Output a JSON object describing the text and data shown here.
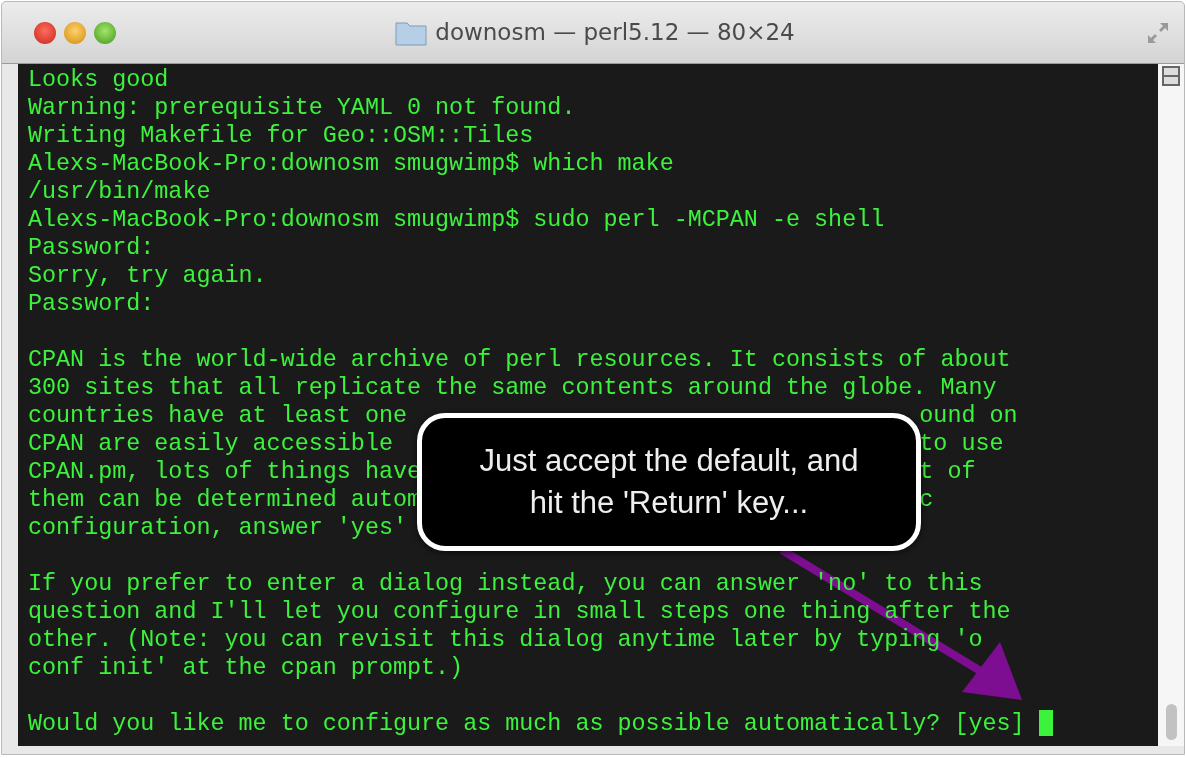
{
  "window": {
    "title": "downosm — perl5.12 — 80×24"
  },
  "terminal": {
    "lines": [
      {
        "kind": "text",
        "text": "Looks good"
      },
      {
        "kind": "text",
        "text": "Warning: prerequisite YAML 0 not found."
      },
      {
        "kind": "text",
        "text": "Writing Makefile for Geo::OSM::Tiles"
      },
      {
        "kind": "text",
        "text": "Alexs-MacBook-Pro:downosm smugwimp$ which make"
      },
      {
        "kind": "text",
        "text": "/usr/bin/make"
      },
      {
        "kind": "text",
        "text": "Alexs-MacBook-Pro:downosm smugwimp$ sudo perl -MCPAN -e shell"
      },
      {
        "kind": "text",
        "text": "Password:"
      },
      {
        "kind": "text",
        "text": "Sorry, try again."
      },
      {
        "kind": "text",
        "text": "Password:"
      },
      {
        "kind": "blank"
      },
      {
        "kind": "text",
        "text": "CPAN is the world-wide archive of perl resources. It consists of about"
      },
      {
        "kind": "text",
        "text": "300 sites that all replicate the same contents around the globe. Many"
      },
      {
        "kind": "text",
        "text": "countries have at least one",
        "tail": "ound on"
      },
      {
        "kind": "text",
        "text": "CPAN are easily accessible",
        "tail": "to use"
      },
      {
        "kind": "text",
        "text": "CPAN.pm, lots of things have",
        "tail": "t of"
      },
      {
        "kind": "text",
        "text": "them can be determined autom",
        "tail": "c"
      },
      {
        "kind": "text",
        "text": "configuration, answer 'yes'"
      },
      {
        "kind": "blank"
      },
      {
        "kind": "text",
        "text": "If you prefer to enter a dialog instead, you can answer 'no' to this"
      },
      {
        "kind": "text",
        "text": "question and I'll let you configure in small steps one thing after the"
      },
      {
        "kind": "text",
        "text": "other. (Note: you can revisit this dialog anytime later by typing 'o"
      },
      {
        "kind": "text",
        "text": "conf init' at the cpan prompt.)"
      },
      {
        "kind": "blank"
      },
      {
        "kind": "text",
        "text": "Would you like me to configure as much as possible automatically? [yes]",
        "cursor": true
      }
    ]
  },
  "callout": {
    "lines": [
      "Just accept the default, and",
      "hit the 'Return' key..."
    ]
  }
}
